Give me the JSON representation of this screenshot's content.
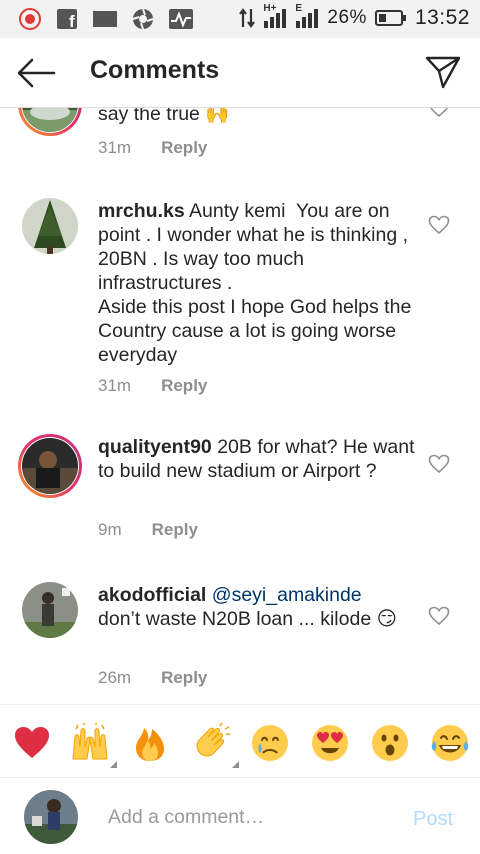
{
  "status_bar": {
    "battery_percent": "26%",
    "time": "13:52",
    "network_h": "H+",
    "network_e": "E"
  },
  "header": {
    "title": "Comments"
  },
  "comments": [
    {
      "username": "",
      "text": "say the true 🙌",
      "time": "31m",
      "reply_label": "Reply"
    },
    {
      "username": "mrchu.ks",
      "text": " Aunty kemi  You are on point . I wonder what he is thinking , 20BN . Is way too much infrastructures .\nAside this post I hope God helps the Country cause a lot is going worse everyday",
      "time": "31m",
      "reply_label": "Reply"
    },
    {
      "username": "qualityent90",
      "text": " 20B for what? He want to build new stadium or Airport ?",
      "time": "9m",
      "reply_label": "Reply"
    },
    {
      "username": "akodofficial",
      "mention": "@seyi_amakinde",
      "text": "don’t waste N20B loan ... kilode 😏",
      "time": "26m",
      "reply_label": "Reply"
    }
  ],
  "emoji_bar": [
    {
      "name": "red-heart",
      "glyph": "❤️"
    },
    {
      "name": "raising-hands",
      "glyph": "🙌"
    },
    {
      "name": "fire",
      "glyph": "🔥"
    },
    {
      "name": "clapping-hands",
      "glyph": "👏"
    },
    {
      "name": "crying-face",
      "glyph": "😢"
    },
    {
      "name": "heart-eyes",
      "glyph": "😍"
    },
    {
      "name": "surprised-face",
      "glyph": "😮"
    },
    {
      "name": "tears-of-joy",
      "glyph": "😂"
    }
  ],
  "input_bar": {
    "placeholder": "Add a comment…",
    "post_label": "Post"
  }
}
